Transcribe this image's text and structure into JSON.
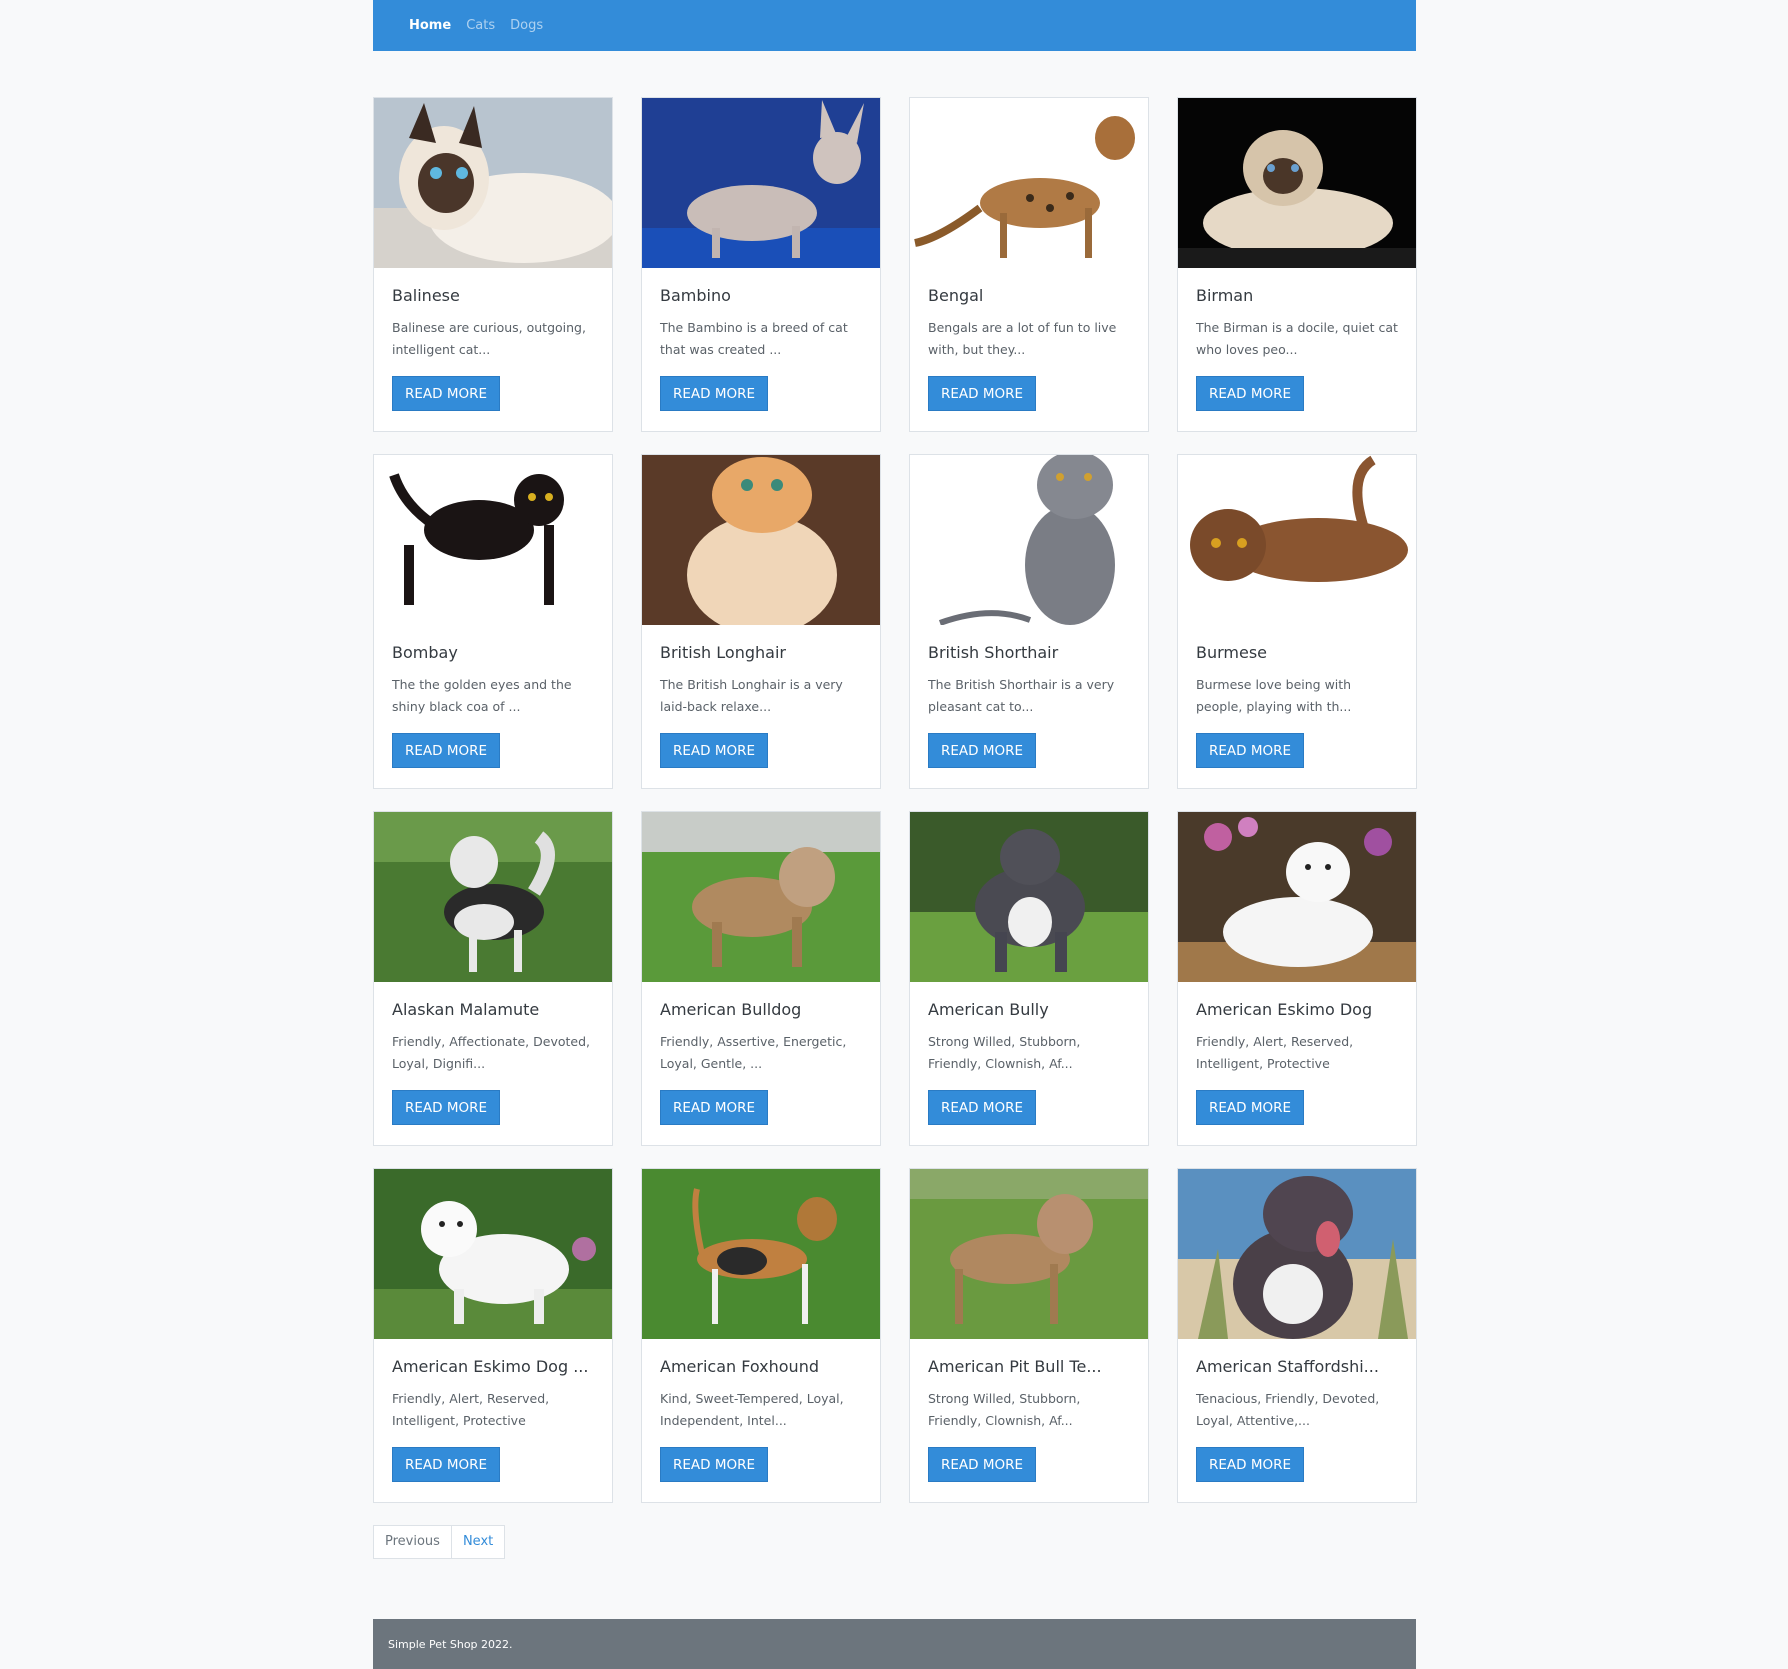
{
  "nav": {
    "items": [
      {
        "label": "Home",
        "active": true
      },
      {
        "label": "Cats",
        "active": false
      },
      {
        "label": "Dogs",
        "active": false
      }
    ]
  },
  "cards": [
    {
      "title": "Balinese",
      "text": "Balinese are curious, outgoing, intelligent cat...",
      "button": "READ MORE",
      "image": "siamese-cat-photo"
    },
    {
      "title": "Bambino",
      "text": "The Bambino is a breed of cat that was created ...",
      "button": "READ MORE",
      "image": "hairless-cat-photo"
    },
    {
      "title": "Bengal",
      "text": "Bengals are a lot of fun to live with, but they...",
      "button": "READ MORE",
      "image": "spotted-cat-photo"
    },
    {
      "title": "Birman",
      "text": "The Birman is a docile, quiet cat who loves peo...",
      "button": "READ MORE",
      "image": "birman-cat-photo"
    },
    {
      "title": "Bombay",
      "text": "The the golden eyes and the shiny black coa of ...",
      "button": "READ MORE",
      "image": "black-cat-photo"
    },
    {
      "title": "British Longhair",
      "text": "The British Longhair is a very laid-back relaxe...",
      "button": "READ MORE",
      "image": "longhair-cat-photo"
    },
    {
      "title": "British Shorthair",
      "text": "The British Shorthair is a very pleasant cat to...",
      "button": "READ MORE",
      "image": "grey-cat-photo"
    },
    {
      "title": "Burmese",
      "text": "Burmese love being with people, playing with th...",
      "button": "READ MORE",
      "image": "brown-cat-photo"
    },
    {
      "title": "Alaskan Malamute",
      "text": "Friendly, Affectionate, Devoted, Loyal, Dignifi...",
      "button": "READ MORE",
      "image": "malamute-dog-photo"
    },
    {
      "title": "American Bulldog",
      "text": "Friendly, Assertive, Energetic, Loyal, Gentle, ...",
      "button": "READ MORE",
      "image": "bulldog-dog-photo"
    },
    {
      "title": "American Bully",
      "text": "Strong Willed, Stubborn, Friendly, Clownish, Af...",
      "button": "READ MORE",
      "image": "bully-dog-photo"
    },
    {
      "title": "American Eskimo Dog",
      "text": "Friendly, Alert, Reserved, Intelligent, Protective",
      "button": "READ MORE",
      "image": "eskimo-dog-photo"
    },
    {
      "title": "American Eskimo Dog ...",
      "text": "Friendly, Alert, Reserved, Intelligent, Protective",
      "button": "READ MORE",
      "image": "white-dog-photo"
    },
    {
      "title": "American Foxhound",
      "text": "Kind, Sweet-Tempered, Loyal, Independent, Intel...",
      "button": "READ MORE",
      "image": "foxhound-dog-photo"
    },
    {
      "title": "American Pit Bull Te...",
      "text": "Strong Willed, Stubborn, Friendly, Clownish, Af...",
      "button": "READ MORE",
      "image": "pitbull-dog-photo"
    },
    {
      "title": "American Staffordshi...",
      "text": "Tenacious, Friendly, Devoted, Loyal, Attentive,...",
      "button": "READ MORE",
      "image": "staffordshire-dog-photo"
    }
  ],
  "pagination": {
    "prev": "Previous",
    "next": "Next"
  },
  "footer": {
    "text": "Simple Pet Shop 2022."
  },
  "colors": {
    "primary": "#338cd9",
    "footer": "#6c757d",
    "background": "#f8f9fa"
  }
}
